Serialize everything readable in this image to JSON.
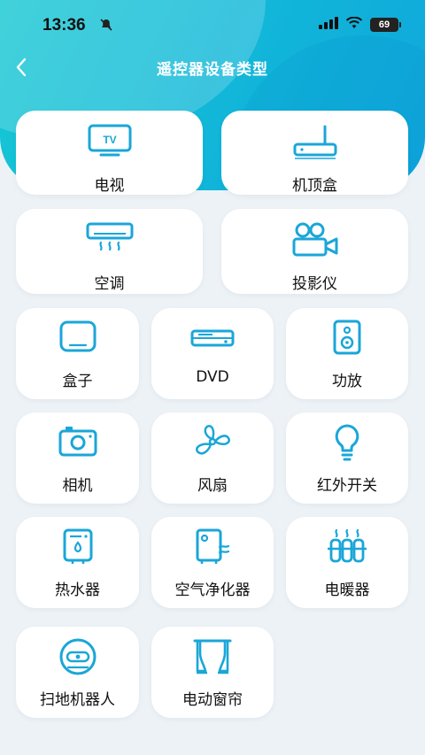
{
  "status_bar": {
    "time": "13:36",
    "battery": "69"
  },
  "nav": {
    "title": "遥控器设备类型"
  },
  "colors": {
    "accent": "#12b9d8",
    "icon": "#1aa6d8"
  },
  "devices": [
    {
      "label": "电视",
      "icon": "tv-icon"
    },
    {
      "label": "机顶盒",
      "icon": "set-top-box-icon"
    },
    {
      "label": "空调",
      "icon": "air-conditioner-icon"
    },
    {
      "label": "投影仪",
      "icon": "projector-icon"
    },
    {
      "label": "盒子",
      "icon": "box-icon"
    },
    {
      "label": "DVD",
      "icon": "dvd-icon"
    },
    {
      "label": "功放",
      "icon": "speaker-icon"
    },
    {
      "label": "相机",
      "icon": "camera-icon"
    },
    {
      "label": "风扇",
      "icon": "fan-icon"
    },
    {
      "label": "红外开关",
      "icon": "bulb-icon"
    },
    {
      "label": "热水器",
      "icon": "water-heater-icon"
    },
    {
      "label": "空气净化器",
      "icon": "air-purifier-icon"
    },
    {
      "label": "电暖器",
      "icon": "heater-icon"
    },
    {
      "label": "扫地机器人",
      "icon": "robot-vacuum-icon"
    },
    {
      "label": "电动窗帘",
      "icon": "curtain-icon"
    }
  ]
}
